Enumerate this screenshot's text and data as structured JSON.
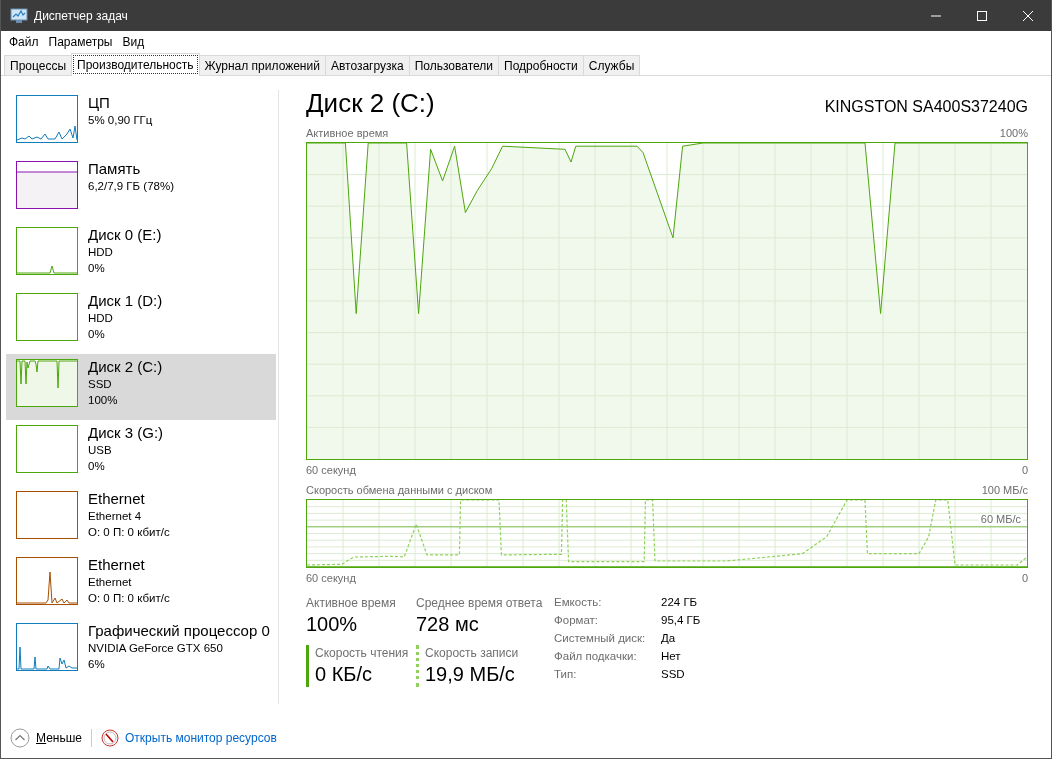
{
  "window": {
    "title": "Диспетчер задач"
  },
  "menu": [
    "Файл",
    "Параметры",
    "Вид"
  ],
  "tabs": [
    {
      "label": "Процессы",
      "selected": false
    },
    {
      "label": "Производительность",
      "selected": true
    },
    {
      "label": "Журнал приложений",
      "selected": false
    },
    {
      "label": "Автозагрузка",
      "selected": false
    },
    {
      "label": "Пользователи",
      "selected": false
    },
    {
      "label": "Подробности",
      "selected": false
    },
    {
      "label": "Службы",
      "selected": false
    }
  ],
  "sidebar": {
    "items": [
      {
        "kind": "cpu",
        "color": "#117dbb",
        "title": "ЦП",
        "lines": [
          "5% 0,90 ГГц"
        ],
        "selected": false
      },
      {
        "kind": "memory",
        "color": "#8b12ae",
        "title": "Память",
        "lines": [
          "6,2/7,9 ГБ (78%)"
        ],
        "selected": false
      },
      {
        "kind": "disk",
        "color": "#4da60c",
        "title": "Диск 0 (E:)",
        "lines": [
          "HDD",
          "0%"
        ],
        "selected": false
      },
      {
        "kind": "disk",
        "color": "#4da60c",
        "title": "Диск 1 (D:)",
        "lines": [
          "HDD",
          "0%"
        ],
        "selected": false
      },
      {
        "kind": "disk",
        "color": "#4da60c",
        "title": "Диск 2 (C:)",
        "lines": [
          "SSD",
          "100%"
        ],
        "selected": true
      },
      {
        "kind": "disk",
        "color": "#4da60c",
        "title": "Диск 3 (G:)",
        "lines": [
          "USB",
          "0%"
        ],
        "selected": false
      },
      {
        "kind": "network",
        "color": "#a74f01",
        "title": "Ethernet",
        "lines": [
          "Ethernet 4",
          "О: 0 П: 0 кбит/с"
        ],
        "selected": false
      },
      {
        "kind": "network",
        "color": "#a74f01",
        "title": "Ethernet",
        "lines": [
          "Ethernet",
          "О: 0 П: 0 кбит/с"
        ],
        "selected": false
      },
      {
        "kind": "gpu",
        "color": "#117dbb",
        "title": "Графический процессор 0",
        "lines": [
          "NVIDIA GeForce GTX 650",
          "6%"
        ],
        "selected": false
      }
    ]
  },
  "detail": {
    "title": "Диск 2 (C:)",
    "model": "KINGSTON SA400S37240G",
    "graphs": [
      {
        "kind": "active",
        "title": "Активное время",
        "top_label": "100%",
        "start_label": "60 секунд",
        "end_label": "0"
      },
      {
        "kind": "transfer",
        "title": "Скорость обмена данными с диском",
        "top_label": "100 МБ/с",
        "reference_label": "60 МБ/с",
        "start_label": "60 секунд",
        "end_label": "0"
      }
    ],
    "stats": [
      {
        "label": "Активное время",
        "value": "100%"
      },
      {
        "label": "Среднее время ответа",
        "value": "728 мс"
      }
    ],
    "speeds": [
      {
        "label": "Скорость чтения",
        "value": "0 КБ/с",
        "kind": "solid"
      },
      {
        "label": "Скорость записи",
        "value": "19,9 МБ/с",
        "kind": "dashed"
      }
    ],
    "properties": [
      {
        "label": "Емкость:",
        "value": "224 ГБ"
      },
      {
        "label": "Формат:",
        "value": "95,4 ГБ"
      },
      {
        "label": "Системный диск:",
        "value": "Да"
      },
      {
        "label": "Файл подкачки:",
        "value": "Нет"
      },
      {
        "label": "Тип:",
        "value": "SSD"
      }
    ]
  },
  "footer": {
    "collapse": "Меньше",
    "link": "Открыть монитор ресурсов"
  }
}
